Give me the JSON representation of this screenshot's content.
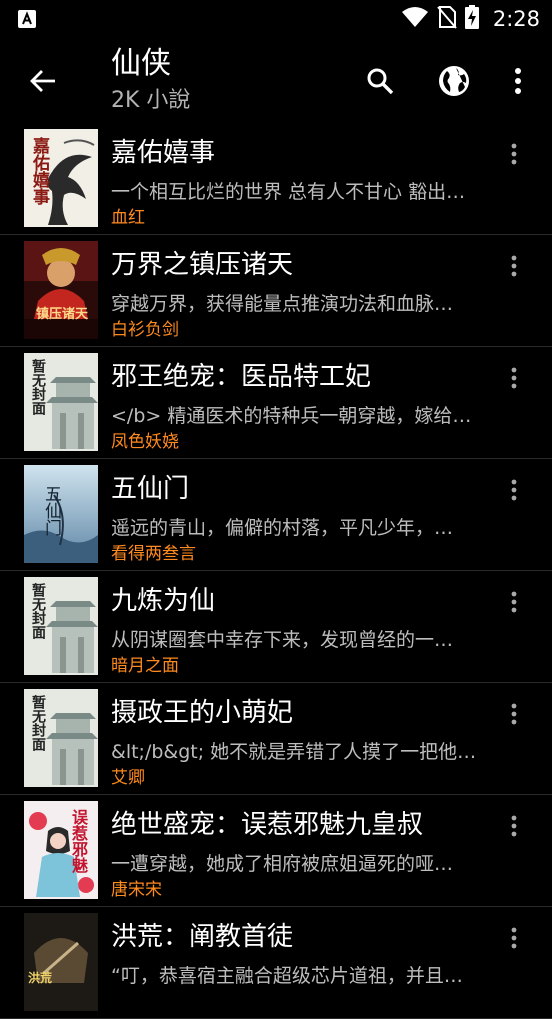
{
  "status_bar": {
    "time": "2:28"
  },
  "header": {
    "title": "仙侠",
    "subtitle": "2K 小說"
  },
  "books": [
    {
      "title": "嘉佑嬉事",
      "description": "一个相互比烂的世界 总有人不甘心 豁出…",
      "author": "血红",
      "cover_text": "嘉佑嬉事"
    },
    {
      "title": "万界之镇压诸天",
      "description": "穿越万界，获得能量点推演功法和血脉…",
      "author": "白衫负剑",
      "cover_text": "镇压诸天"
    },
    {
      "title": "邪王绝宠：医品特工妃",
      "description": "</b> 精通医术的特种兵一朝穿越，嫁给…",
      "author": "凤色妖娆",
      "cover_text": "暂无封面"
    },
    {
      "title": "五仙门",
      "description": "遥远的青山，偏僻的村落，平凡少年，…",
      "author": "看得两叁言",
      "cover_text": "五仙门"
    },
    {
      "title": "九炼为仙",
      "description": "从阴谋圈套中幸存下来，发现曾经的一…",
      "author": "暗月之面",
      "cover_text": "暂无封面"
    },
    {
      "title": "摄政王的小萌妃",
      "description": "&lt;/b&gt; 她不就是弄错了人摸了一把他…",
      "author": "艾卿",
      "cover_text": "暂无封面"
    },
    {
      "title": "绝世盛宠：误惹邪魅九皇叔",
      "description": "一遭穿越，她成了相府被庶姐逼死的哑…",
      "author": "唐宋宋",
      "cover_text": "误惹邪魅"
    },
    {
      "title": "洪荒：阐教首徒",
      "description": "“叮，恭喜宿主融合超级芯片道祖，并且…",
      "author": "",
      "cover_text": "洪荒"
    }
  ]
}
